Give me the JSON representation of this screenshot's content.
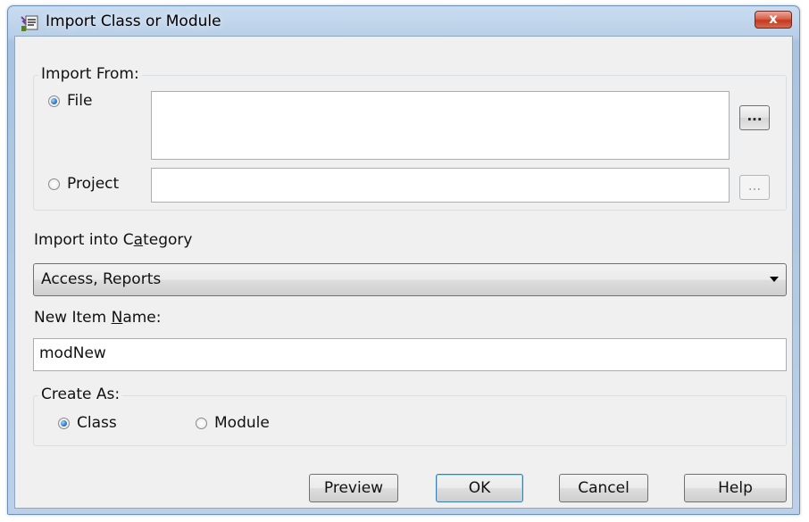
{
  "window": {
    "title": "Import Class or Module",
    "close_label": "x"
  },
  "import_from": {
    "legend": "Import From:",
    "file_label": "File",
    "file_selected": true,
    "file_value": "",
    "project_label": "Project",
    "project_selected": false,
    "project_value": "",
    "browse_label": "...",
    "browse_project_label": "..."
  },
  "category": {
    "label_prefix": "Import into C",
    "label_accel": "a",
    "label_suffix": "tegory",
    "selected": "Access, Reports"
  },
  "item_name": {
    "label_prefix": "New Item ",
    "label_accel": "N",
    "label_suffix": "ame:",
    "value": "modNew"
  },
  "create_as": {
    "legend": "Create As:",
    "class_label": "Class",
    "class_selected": true,
    "module_label": "Module",
    "module_selected": false
  },
  "buttons": {
    "preview": "Preview",
    "ok": "OK",
    "cancel": "Cancel",
    "help": "Help"
  },
  "icons": {
    "app": "import-wizard-icon",
    "close": "close-icon",
    "dropdown": "chevron-down-icon"
  }
}
